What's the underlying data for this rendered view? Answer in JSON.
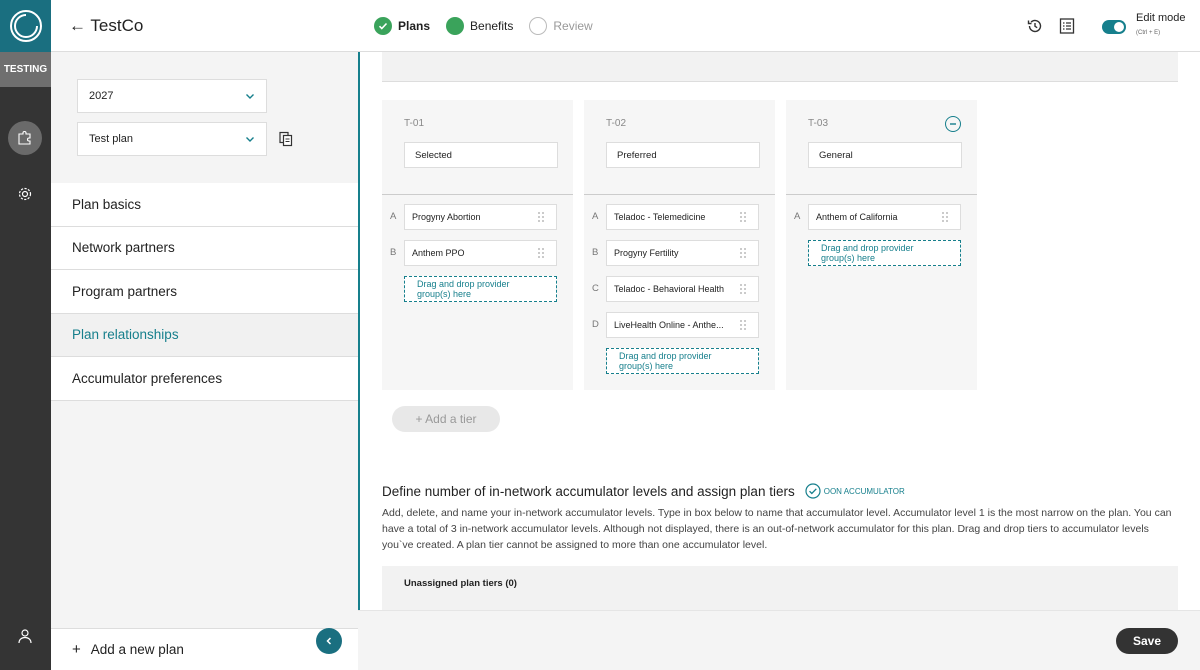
{
  "rail": {
    "env_label": "TESTING"
  },
  "header": {
    "back_label": "← TestCo",
    "steps": [
      "Plans",
      "Benefits",
      "Review"
    ],
    "edit_mode_label": "Edit mode",
    "edit_mode_shortcut": "(Ctrl + E)"
  },
  "sidebar": {
    "year_select": "2027",
    "plan_select": "Test plan",
    "nav": [
      "Plan basics",
      "Network partners",
      "Program partners",
      "Plan relationships",
      "Accumulator preferences"
    ],
    "add_plan": "Add a new plan"
  },
  "tiers": [
    {
      "id": "T-01",
      "name": "Selected",
      "providers": [
        {
          "letter": "A",
          "name": "Progyny Abortion"
        },
        {
          "letter": "B",
          "name": "Anthem PPO"
        }
      ]
    },
    {
      "id": "T-02",
      "name": "Preferred",
      "providers": [
        {
          "letter": "A",
          "name": "Teladoc - Telemedicine"
        },
        {
          "letter": "B",
          "name": "Progyny Fertility"
        },
        {
          "letter": "C",
          "name": "Teladoc - Behavioral Health"
        },
        {
          "letter": "D",
          "name": "LiveHealth Online - Anthe..."
        }
      ]
    },
    {
      "id": "T-03",
      "name": "General",
      "providers": [
        {
          "letter": "A",
          "name": "Anthem of California"
        }
      ]
    }
  ],
  "dropzone_text": "Drag and drop provider group(s) here",
  "add_tier": "+ Add a tier",
  "accumulator": {
    "heading": "Define number of in-network accumulator levels and assign plan tiers",
    "oon_badge": "OON ACCUMULATOR",
    "description": "Add, delete, and name your in-network accumulator levels. Type in box below to name that accumulator level. Accumulator level 1 is the most narrow on the plan. You can have a total of 3 in-network accumulator levels. Although not displayed, there is an out-of-network accumulator for this plan. Drag and drop tiers to accumulator levels you`ve created. A plan tier cannot be assigned to more than one accumulator level.",
    "unassigned_label": "Unassigned plan tiers (0)"
  },
  "footer": {
    "save_label": "Save"
  },
  "colors": {
    "accent": "#167f8c",
    "rail": "#343434",
    "logo_bg": "#1a6f80"
  }
}
